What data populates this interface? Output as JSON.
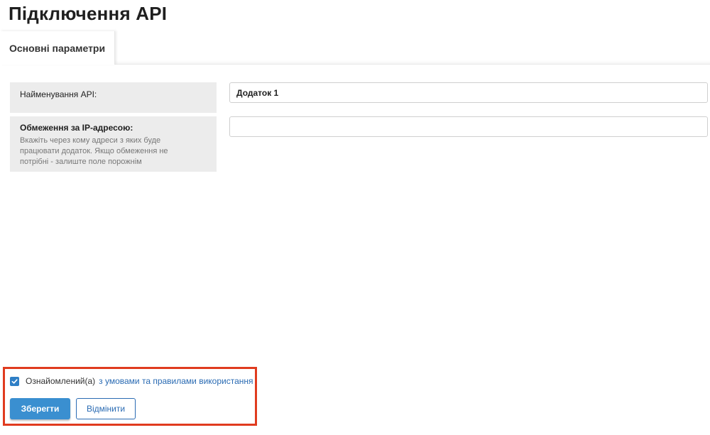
{
  "page": {
    "title": "Підключення API"
  },
  "tabs": [
    {
      "label": "Основні параметри",
      "active": true
    }
  ],
  "form": {
    "api_name": {
      "label": "Найменування API:",
      "value": "Додаток 1"
    },
    "ip_restriction": {
      "label": "Обмеження за IP-адресою:",
      "hint": "Вкажіть через кому адреси з яких буде працювати додаток. Якщо обмеження не потрібні - залиште поле порожнім",
      "value": ""
    }
  },
  "footer": {
    "agree_checked": true,
    "agree_text": "Ознайомлений(а)",
    "agree_link": "з умовами та правилами використання",
    "save_label": "Зберегти",
    "cancel_label": "Відмінити"
  },
  "colors": {
    "accent": "#3a8fd0",
    "link": "#2a6bb3",
    "highlight_border": "#e03b1f",
    "label_bg": "#ececec"
  }
}
